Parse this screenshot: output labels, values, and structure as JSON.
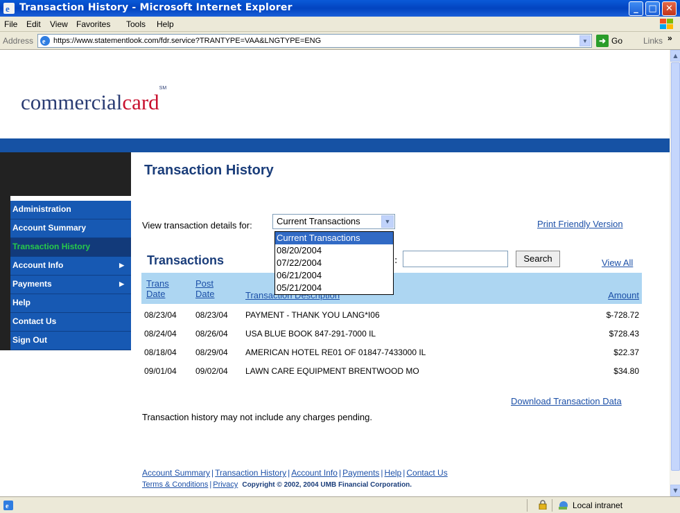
{
  "window": {
    "title": "Transaction History - Microsoft Internet Explorer"
  },
  "menu": [
    "File",
    "Edit",
    "View",
    "Favorites",
    "Tools",
    "Help"
  ],
  "address": {
    "label": "Address",
    "url": "https://www.statementlook.com/fdr.service?TRANTYPE=VAA&LNGTYPE=ENG",
    "go_label": "Go",
    "links_label": "Links"
  },
  "status": {
    "zone": "Local intranet"
  },
  "logo": {
    "part1": "commercial",
    "part2": "card",
    "mark": "SM"
  },
  "sidebar": {
    "items": [
      {
        "label": "Administration",
        "arrow": false,
        "active": false
      },
      {
        "label": "Account Summary",
        "arrow": false,
        "active": false
      },
      {
        "label": "Transaction History",
        "arrow": false,
        "active": true
      },
      {
        "label": "Account Info",
        "arrow": true,
        "active": false
      },
      {
        "label": "Payments",
        "arrow": true,
        "active": false
      },
      {
        "label": "Help",
        "arrow": false,
        "active": false
      },
      {
        "label": "Contact Us",
        "arrow": false,
        "active": false
      },
      {
        "label": "Sign Out",
        "arrow": false,
        "active": false
      }
    ]
  },
  "main": {
    "title": "Transaction History",
    "view_label": "View transaction details for:",
    "select_value": "Current Transactions",
    "dropdown_options": [
      "Current Transactions",
      "08/20/2004",
      "07/22/2004",
      "06/21/2004",
      "05/21/2004"
    ],
    "print_link": "Print Friendly Version",
    "transactions_heading": "Transactions",
    "search_button": "Search",
    "view_all": "View All",
    "columns": {
      "trans_date": "Trans Date",
      "post_date": "Post Date",
      "description": "Transaction Description",
      "amount": "Amount"
    },
    "rows": [
      {
        "trans": "08/23/04",
        "post": "08/23/04",
        "desc": "PAYMENT - THANK YOU LANG*I06",
        "amount": "$-728.72"
      },
      {
        "trans": "08/24/04",
        "post": "08/26/04",
        "desc": "USA BLUE BOOK 847-291-7000 IL",
        "amount": "$728.43"
      },
      {
        "trans": "08/18/04",
        "post": "08/29/04",
        "desc": "AMERICAN HOTEL RE01 OF 01847-7433000 IL",
        "amount": "$22.37"
      },
      {
        "trans": "09/01/04",
        "post": "09/02/04",
        "desc": "LAWN CARE EQUIPMENT BRENTWOOD MO",
        "amount": "$34.80"
      }
    ],
    "download_link": "Download Transaction Data",
    "note": "Transaction history may not include any charges pending."
  },
  "footer": {
    "links": [
      "Account Summary",
      "Transaction History",
      "Account Info",
      "Payments",
      "Help",
      "Contact Us"
    ],
    "terms": "Terms & Conditions",
    "privacy": "Privacy",
    "copyright": "Copyright © 2002, 2004 UMB Financial Corporation."
  },
  "colors": {
    "brand_blue": "#1652a4",
    "active_green": "#27c94a",
    "table_header": "#add6f2",
    "logo_red": "#c8102e"
  }
}
